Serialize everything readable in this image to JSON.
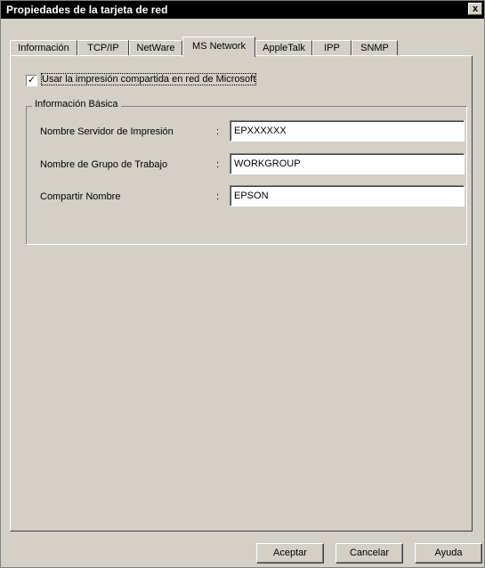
{
  "window": {
    "title": "Propiedades de la tarjeta de red",
    "close_label": "x"
  },
  "tabs": [
    {
      "label": "Información"
    },
    {
      "label": "TCP/IP"
    },
    {
      "label": "NetWare"
    },
    {
      "label": "MS Network",
      "active": true
    },
    {
      "label": "AppleTalk"
    },
    {
      "label": "IPP"
    },
    {
      "label": "SNMP"
    }
  ],
  "share_checkbox": {
    "label": "Usar la impresión compartida en red de Microsoft",
    "checked": true,
    "mark": "✓"
  },
  "basic_info": {
    "title": "Información Básica",
    "fields": [
      {
        "label": "Nombre Servidor de Impresión",
        "colon": ":",
        "value": "EPXXXXXX"
      },
      {
        "label": "Nombre de Grupo de Trabajo",
        "colon": ":",
        "value": "WORKGROUP"
      },
      {
        "label": "Compartir Nombre",
        "colon": ":",
        "value": "EPSON"
      }
    ]
  },
  "buttons": {
    "ok": "Aceptar",
    "cancel": "Cancelar",
    "help": "Ayuda"
  }
}
